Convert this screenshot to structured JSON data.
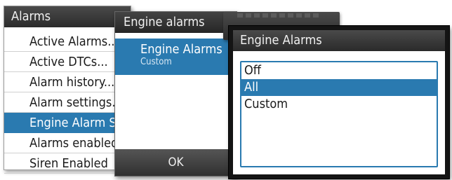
{
  "alarms_menu": {
    "title": "Alarms",
    "items": [
      {
        "label": "Active Alarms..."
      },
      {
        "label": "Active DTCs..."
      },
      {
        "label": "Alarm history..."
      },
      {
        "label": "Alarm settings..."
      },
      {
        "label": "Engine Alarm Se",
        "selected": true
      },
      {
        "label": "Alarms enabled"
      },
      {
        "label": "Siren Enabled"
      }
    ]
  },
  "engine_alarms_panel": {
    "title": "Engine alarms",
    "item_label": "Engine Alarms",
    "item_value": "Custom",
    "ok_label": "OK"
  },
  "engine_alarms_dialog": {
    "title": "Engine Alarms",
    "options": [
      {
        "label": "Off"
      },
      {
        "label": "All",
        "selected": true
      },
      {
        "label": "Custom"
      }
    ]
  },
  "colors": {
    "accent": "#2a7ab0",
    "title_bar": "#2b2b2b"
  }
}
